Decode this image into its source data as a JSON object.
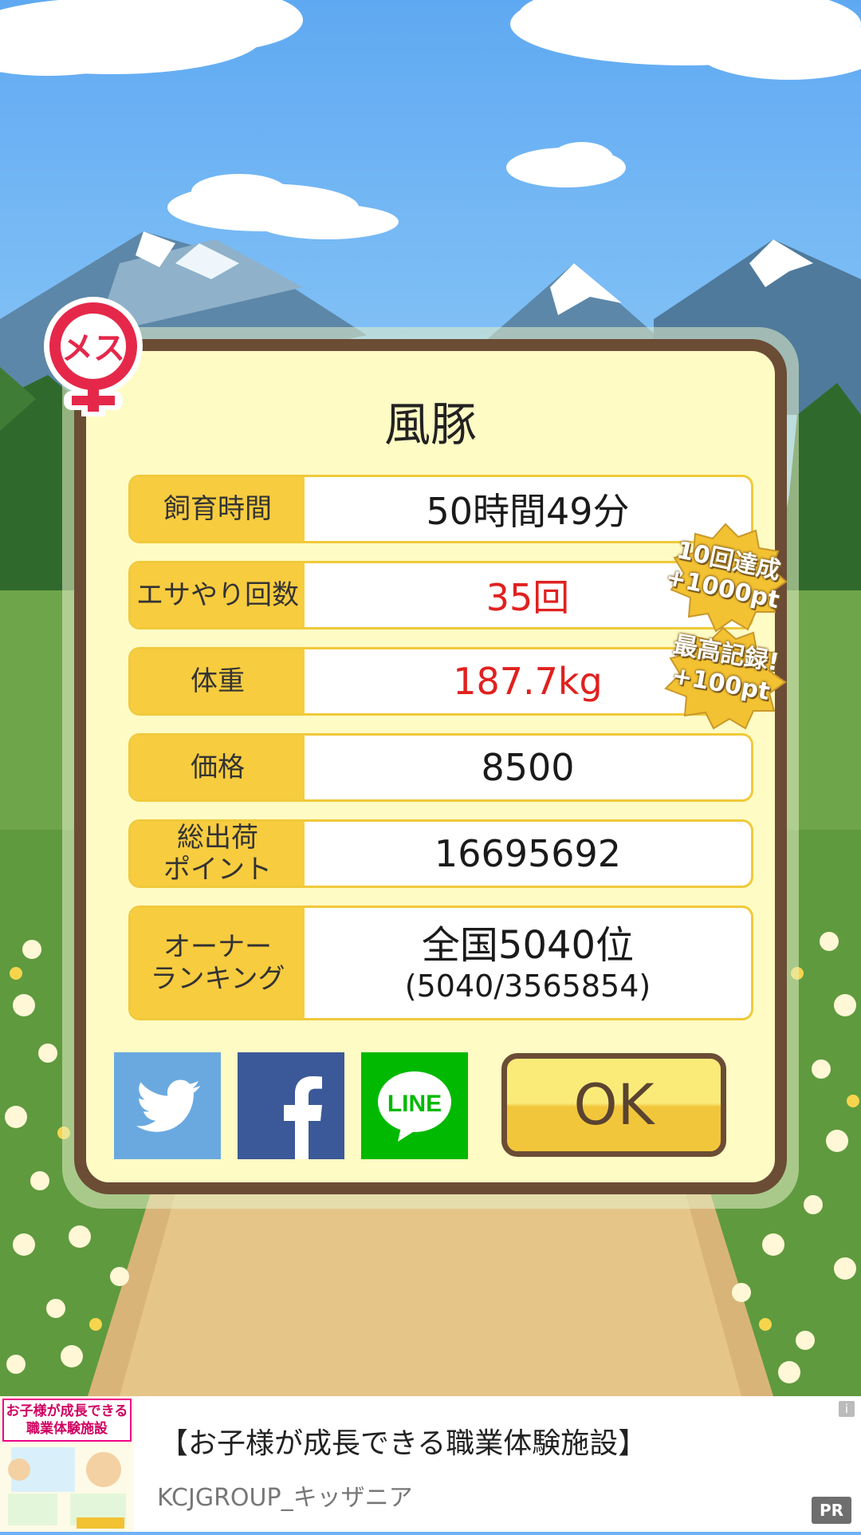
{
  "pig_name": "風豚",
  "gender_badge": {
    "label": "メス",
    "icon": "female-symbol-icon"
  },
  "stats": [
    {
      "label": "飼育時間",
      "value": "50時間49分",
      "highlight": false
    },
    {
      "label": "エサやり回数",
      "value": "35回",
      "highlight": true
    },
    {
      "label": "体重",
      "value": "187.7kg",
      "highlight": true
    },
    {
      "label": "価格",
      "value": "8500",
      "highlight": false
    },
    {
      "label_line1": "総出荷",
      "label_line2": "ポイント",
      "value": "16695692",
      "highlight": false
    }
  ],
  "ranking": {
    "label_line1": "オーナー",
    "label_line2": "ランキング",
    "rank": "全国5040位",
    "detail": "(5040/3565854)"
  },
  "bonus_badges": [
    {
      "line1": "10回達成",
      "line2": "+1000pt"
    },
    {
      "line1": "最高記録!",
      "line2": "+100pt"
    }
  ],
  "share_buttons": [
    {
      "name": "twitter",
      "icon": "twitter-bird-icon",
      "color": "#6aa9e0"
    },
    {
      "name": "facebook",
      "icon": "facebook-f-icon",
      "color": "#3b5998"
    },
    {
      "name": "line",
      "icon": "line-icon",
      "label": "LINE",
      "color": "#00b900"
    }
  ],
  "ok_label": "OK",
  "ad": {
    "title": "【お子様が成長できる職業体験施設】",
    "sponsor": "KCJGROUP_キッザニア",
    "pr_label": "PR",
    "info_label": "i",
    "image_text": "お子様が成長できる職業体験施設"
  },
  "colors": {
    "dialog_border": "#6b4c35",
    "dialog_bg": "#fffbc4",
    "label_bg": "#f7cc3f",
    "highlight_text": "#e0211f"
  }
}
